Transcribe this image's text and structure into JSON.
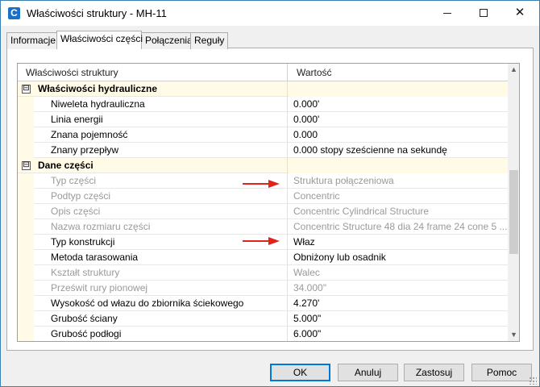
{
  "window": {
    "title": "Właściwości struktury - MH-11",
    "app_icon_letter": "C",
    "controls": {
      "minimize": "minimize-icon",
      "maximize": "maximize-icon",
      "close": "close-icon",
      "close_glyph": "✕"
    }
  },
  "tabs": [
    {
      "label": "Informacje",
      "active": false
    },
    {
      "label": "Właściwości części",
      "active": true
    },
    {
      "label": "Połączenia",
      "active": false
    },
    {
      "label": "Reguły",
      "active": false
    }
  ],
  "grid": {
    "headers": {
      "name": "Właściwości struktury",
      "value": "Wartość"
    },
    "rows": [
      {
        "type": "category",
        "toggle": "⊟",
        "name": "Właściwości hydrauliczne",
        "value": ""
      },
      {
        "type": "editable",
        "name": "Niweleta hydrauliczna",
        "value": "0.000'"
      },
      {
        "type": "editable",
        "name": "Linia energii",
        "value": "0.000'"
      },
      {
        "type": "editable",
        "name": "Znana pojemność",
        "value": "0.000"
      },
      {
        "type": "editable",
        "name": "Znany przepływ",
        "value": "0.000 stopy sześcienne na sekundę"
      },
      {
        "type": "category",
        "toggle": "⊟",
        "name": "Dane części",
        "value": ""
      },
      {
        "type": "readonly",
        "name": "Typ części",
        "value": "Struktura połączeniowa"
      },
      {
        "type": "readonly",
        "name": "Podtyp części",
        "value": "Concentric"
      },
      {
        "type": "readonly",
        "name": "Opis części",
        "value": "Concentric Cylindrical Structure"
      },
      {
        "type": "readonly",
        "name": "Nazwa rozmiaru części",
        "value": "Concentric Structure 48 dia 24 frame 24 cone 5 ..."
      },
      {
        "type": "editable",
        "name": "Typ konstrukcji",
        "value": "Właz"
      },
      {
        "type": "editable",
        "name": "Metoda tarasowania",
        "value": "Obniżony lub osadnik"
      },
      {
        "type": "readonly",
        "name": "Kształt struktury",
        "value": "Walec"
      },
      {
        "type": "readonly",
        "name": "Prześwit rury pionowej",
        "value": "34.000\""
      },
      {
        "type": "editable",
        "name": "Wysokość od włazu do zbiornika ściekowego",
        "value": "4.270'"
      },
      {
        "type": "editable",
        "name": "Grubość ściany",
        "value": "5.000\""
      },
      {
        "type": "editable",
        "name": "Grubość podłogi",
        "value": "6.000\""
      }
    ],
    "scrollbar": {
      "up_glyph": "▲",
      "down_glyph": "▼"
    }
  },
  "annotations": {
    "arrow_color": "#e0231b",
    "arrows_point_to": [
      "Typ części",
      "Typ konstrukcji"
    ]
  },
  "buttons": {
    "ok": "OK",
    "cancel": "Anuluj",
    "apply": "Zastosuj",
    "help": "Pomoc"
  },
  "colors": {
    "category_background": "#fffbe6",
    "readonly_text": "#9a9a9a",
    "default_button_border": "#0078d7"
  }
}
